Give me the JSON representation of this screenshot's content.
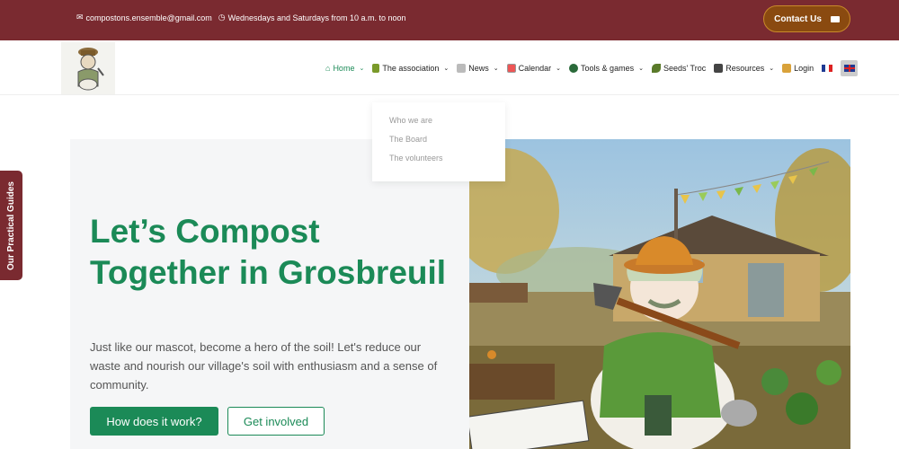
{
  "topbar": {
    "email": "compostons.ensemble@gmail.com",
    "hours": "Wednesdays and Saturdays from 10 a.m. to noon",
    "contact_label": "Contact Us",
    "bg_color": "#7a2a30"
  },
  "nav": {
    "home": "Home",
    "association": "The association",
    "news": "News",
    "calendar": "Calendar",
    "tools": "Tools & games",
    "seeds": "Seeds' Troc",
    "resources": "Resources",
    "login": "Login"
  },
  "dropdown": [
    "Who we are",
    "The Board",
    "The volunteers"
  ],
  "side_tab": "Our Practical Guides",
  "hero": {
    "title": "Let’s Compost Together in Grosbreuil",
    "text": "Just like our mascot, become a hero of the soil! Let's reduce our waste and nourish our village's soil with enthusiasm and a sense of community.",
    "primary_button": "How does it work?",
    "secondary_button": "Get involved",
    "accent_color": "#1b8a57"
  }
}
